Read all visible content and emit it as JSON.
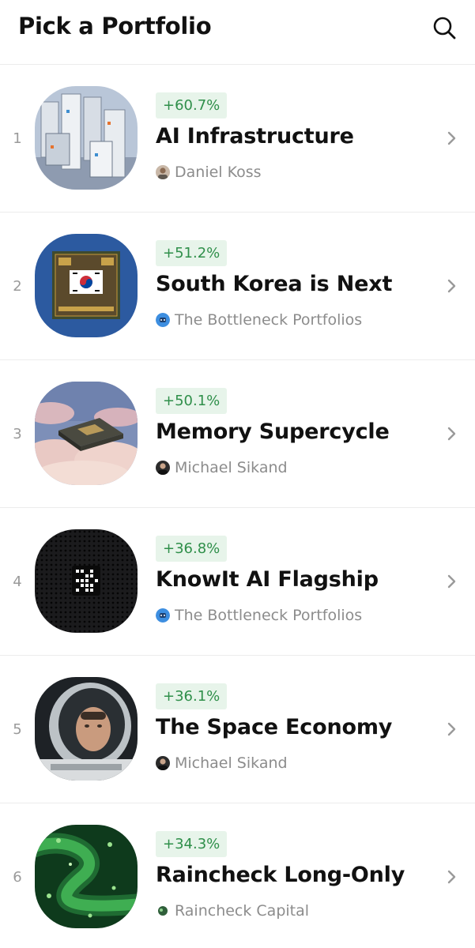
{
  "header": {
    "title": "Pick a Portfolio",
    "search_icon": "search-icon"
  },
  "colors": {
    "return_text": "#2f8f4a",
    "return_bg": "#e7f4ea",
    "rank": "#9a9a9a",
    "author": "#8c8c8c",
    "divider": "#ececec"
  },
  "portfolios": [
    {
      "rank": "1",
      "return": "+60.7%",
      "name": "AI Infrastructure",
      "author": "Daniel Koss",
      "thumbnail": "server-racks-image",
      "avatar": "person-avatar"
    },
    {
      "rank": "2",
      "return": "+51.2%",
      "name": "South Korea is Next",
      "author": "The Bottleneck Portfolios",
      "thumbnail": "korean-flag-circuit-board-image",
      "avatar": "bottleneck-logo-avatar"
    },
    {
      "rank": "3",
      "return": "+50.1%",
      "name": "Memory Supercycle",
      "author": "Michael Sikand",
      "thumbnail": "chip-over-clouds-image",
      "avatar": "person-avatar"
    },
    {
      "rank": "4",
      "return": "+36.8%",
      "name": "KnowIt AI Flagship",
      "author": "The Bottleneck Portfolios",
      "thumbnail": "black-speaker-device-image",
      "avatar": "bottleneck-logo-avatar"
    },
    {
      "rank": "5",
      "return": "+36.1%",
      "name": "The Space Economy",
      "author": "Michael Sikand",
      "thumbnail": "astronaut-helmet-image",
      "avatar": "person-avatar"
    },
    {
      "rank": "6",
      "return": "+34.3%",
      "name": "Raincheck Long-Only",
      "author": "Raincheck Capital",
      "thumbnail": "green-circuit-image",
      "avatar": "raincheck-logo-avatar"
    }
  ]
}
